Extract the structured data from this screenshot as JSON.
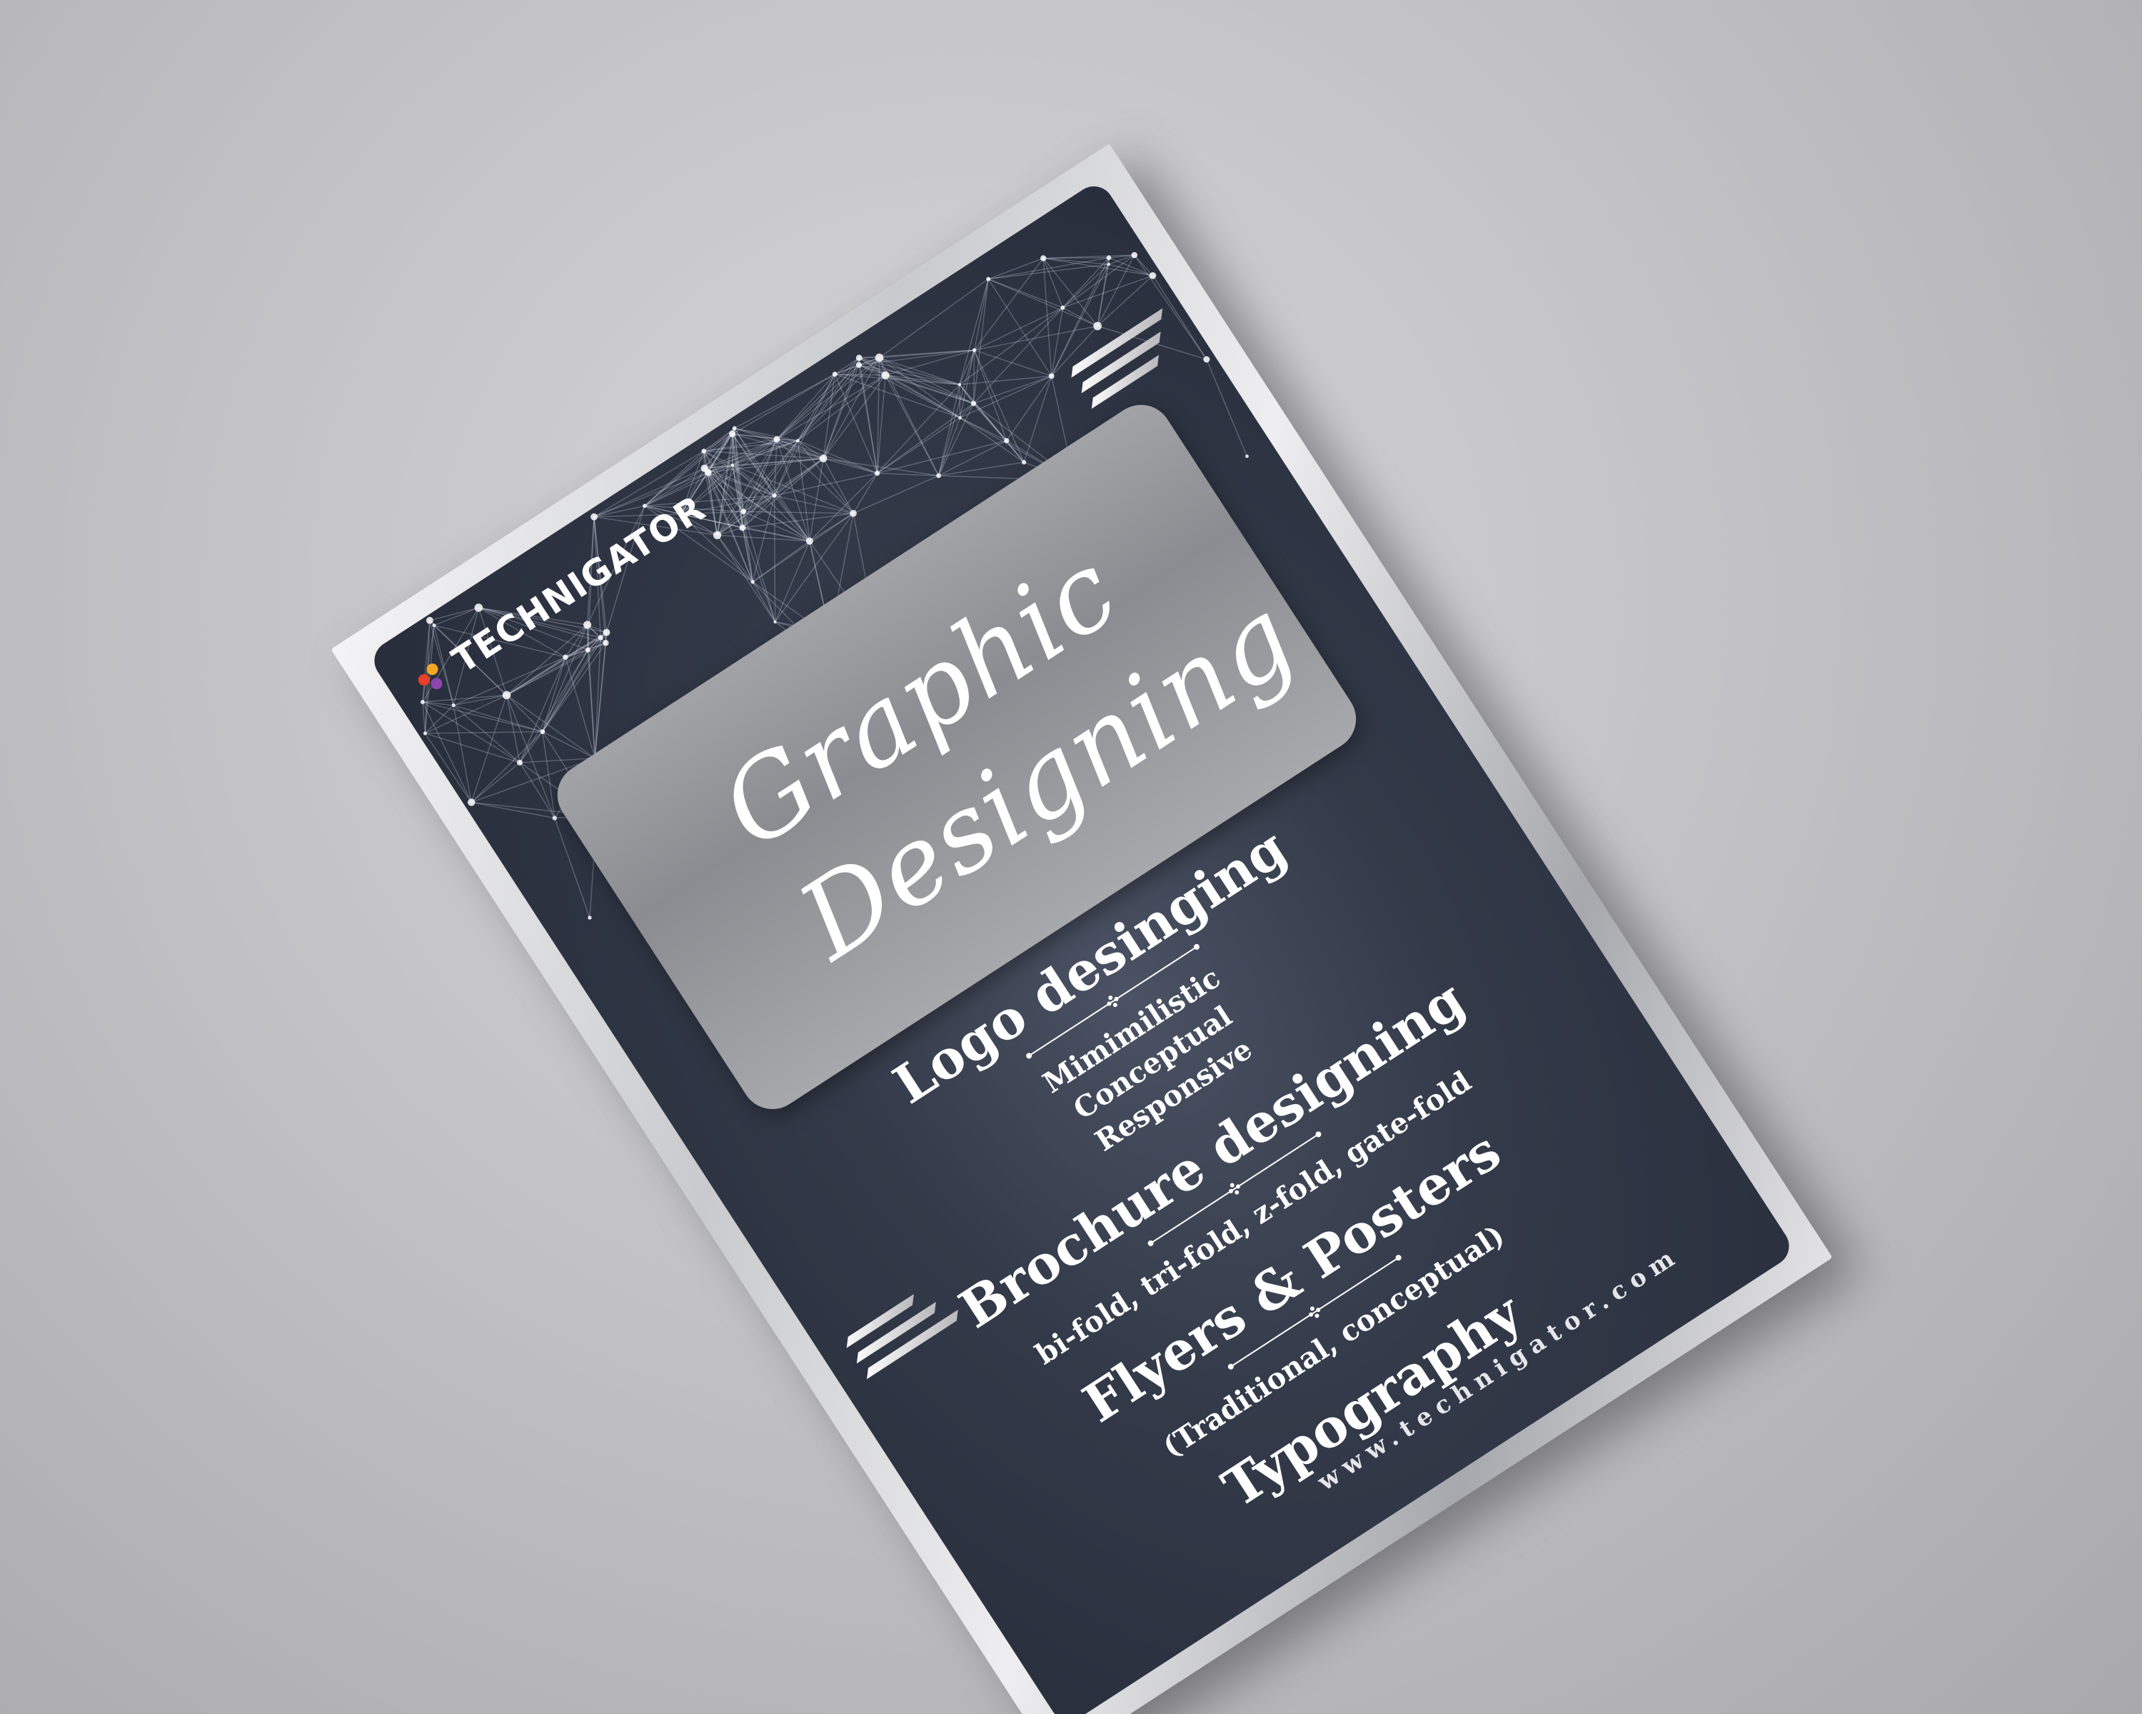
{
  "brand": {
    "name": "TECHNIGATOR",
    "dot_colors": [
      "#e8402a",
      "#f5a623",
      "#8e44ad"
    ]
  },
  "title": {
    "line1": "Graphic",
    "line2": "Designing"
  },
  "services": [
    {
      "heading": "Logo desinging",
      "subs": [
        "Mimimilistic",
        "Conceptual",
        "Responsive"
      ]
    },
    {
      "heading": "Brochure designing",
      "subs": [
        "bi-fold, tri-fold, z-fold, gate-fold"
      ]
    },
    {
      "heading": "Flyers & Posters",
      "subs": [
        "(Traditional, conceptual)"
      ]
    },
    {
      "heading": "Typography",
      "subs": []
    }
  ],
  "website": "www.technigator.com",
  "colors": {
    "background": "#c6c6c9",
    "flyer_panel": "#333a49",
    "title_panel": "#97989c",
    "text": "#ffffff"
  }
}
